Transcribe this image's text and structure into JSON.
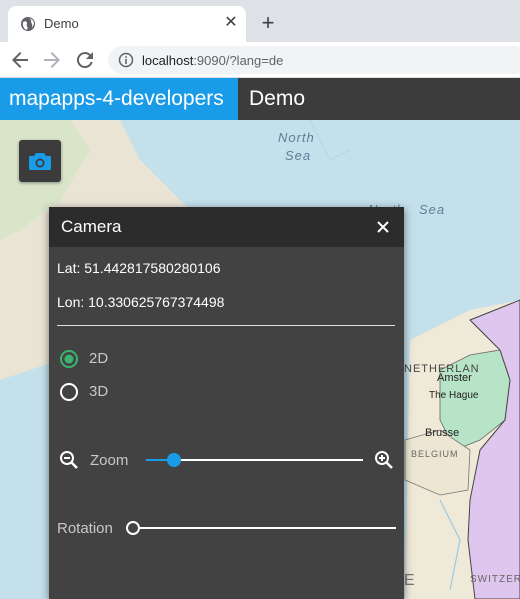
{
  "browser": {
    "tab_title": "Demo",
    "url_host": "localhost",
    "url_rest": ":9090/?lang=de"
  },
  "app": {
    "name": "mapapps-4-developers",
    "title": "Demo"
  },
  "map": {
    "labels": {
      "north": "North",
      "sea1": "Sea",
      "north2": "North",
      "sea2": "Sea",
      "netherlands": "NETHERLAN",
      "amsterdam": "Amster",
      "hague": "The Hague",
      "brussels": "Brusse",
      "belgium": "BELGIUM",
      "switzerland": "SWITZER",
      "e": "E"
    }
  },
  "camera_panel": {
    "title": "Camera",
    "lat": "Lat: 51.442817580280106",
    "lon": "Lon: 10.330625767374498",
    "view_options": [
      "2D",
      "3D"
    ],
    "selected_view": "2D",
    "zoom_label": "Zoom",
    "zoom_level": 0.13,
    "rotation_label": "Rotation",
    "rotation_level": 0.0
  },
  "colors": {
    "accent": "#1a9be8",
    "radio_selected": "#3cb371",
    "panel_bg": "#424242",
    "header_bg": "#2c2c2c"
  }
}
